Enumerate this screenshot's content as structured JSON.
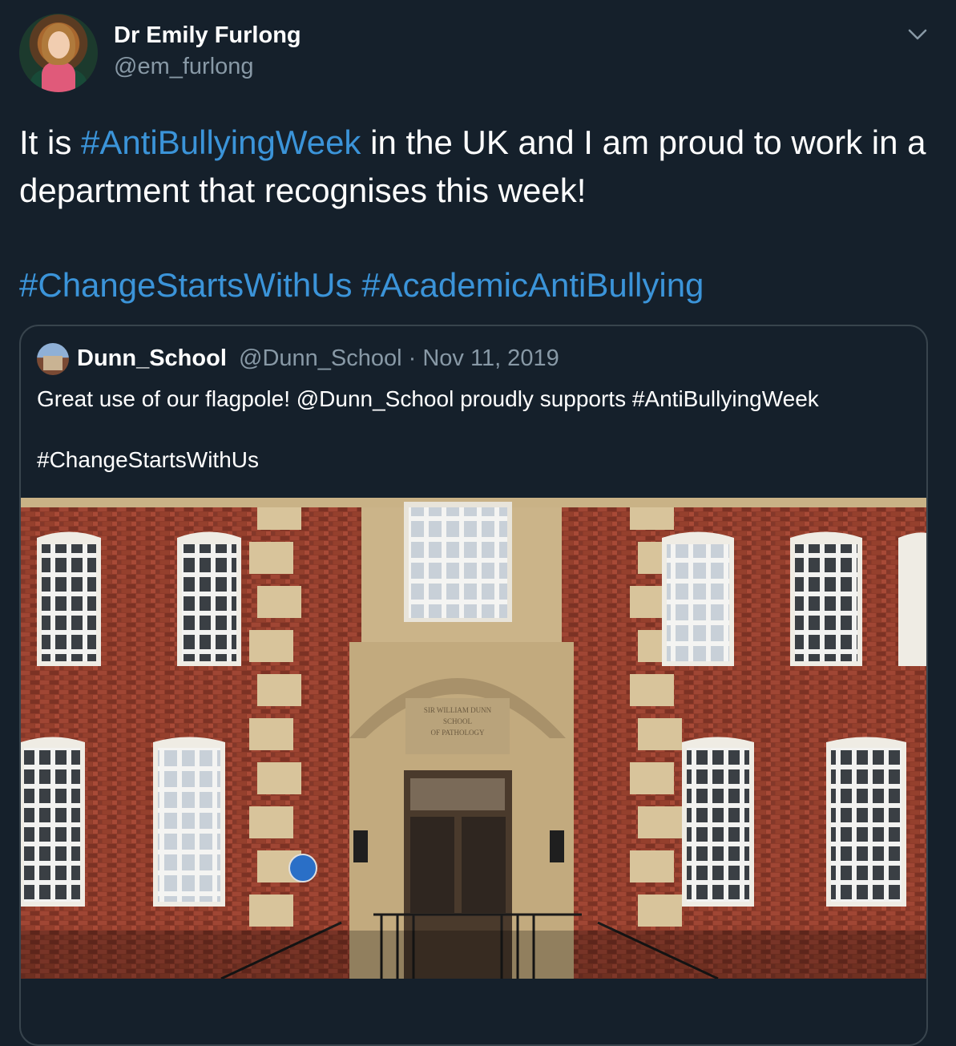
{
  "tweet": {
    "author_name": "Dr Emily Furlong",
    "author_handle": "@em_furlong",
    "text_before": "It is ",
    "hashtag_1": "#AntiBullyingWeek",
    "text_after": " in the UK and I am proud to work in a department that recognises this week!",
    "hashtag_2": "#ChangeStartsWithUs",
    "hashtag_3": "#AcademicAntiBullying"
  },
  "quoted": {
    "name": "Dunn_School",
    "handle_date": "@Dunn_School · Nov 11, 2019",
    "text": "Great use of our flagpole! @Dunn_School proudly supports #AntiBullyingWeek",
    "tags": "#ChangeStartsWithUs",
    "inscription_1": "SIR WILLIAM DUNN",
    "inscription_2": "SCHOOL",
    "inscription_3": "OF PATHOLOGY"
  },
  "colors": {
    "background": "#15202b",
    "hashtag": "#1da1f2",
    "secondary_text": "#8899a6",
    "border": "#38444d"
  },
  "icons": {
    "menu": "chevron-down-icon"
  }
}
